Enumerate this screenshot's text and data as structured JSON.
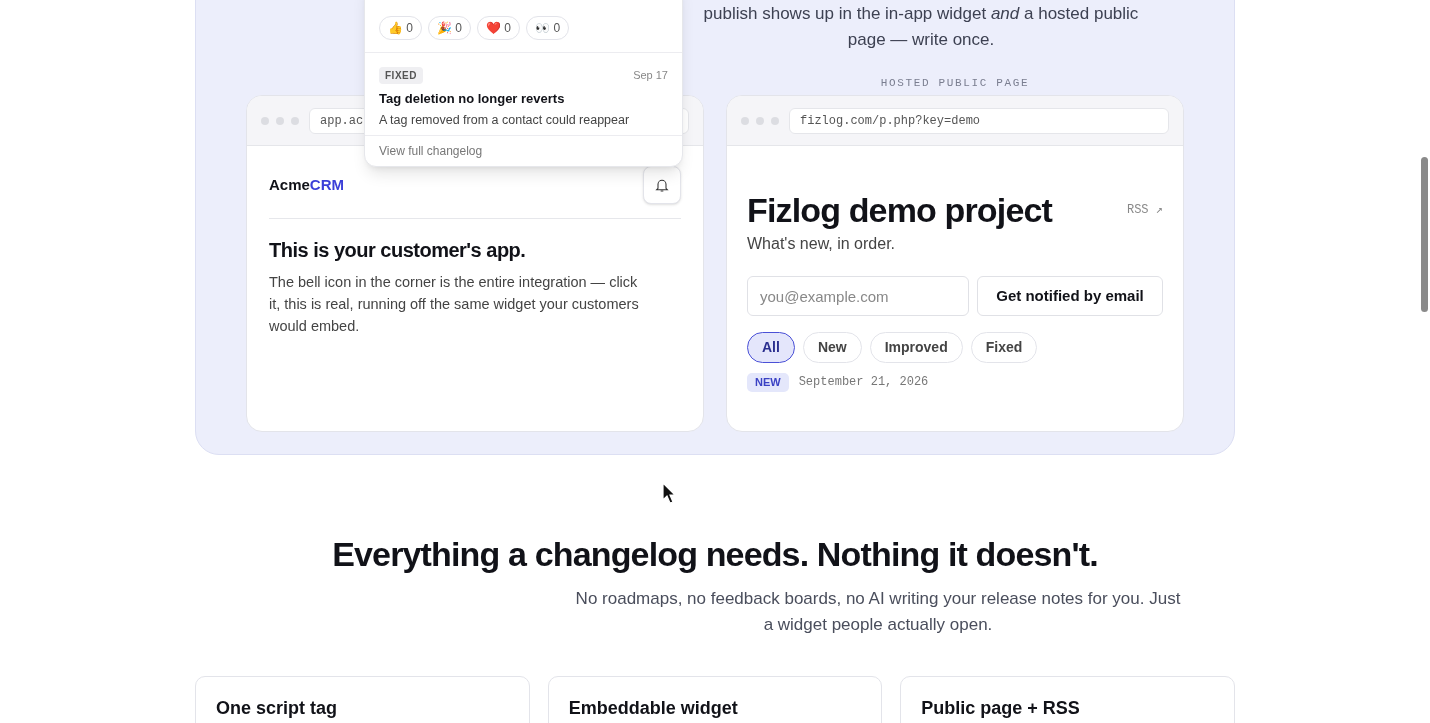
{
  "intro": {
    "text": "publish shows up in the in-app widget *and* a hosted public page — write once."
  },
  "widget_popup": {
    "reactions": [
      {
        "emoji": "👍",
        "count": "0"
      },
      {
        "emoji": "🎉",
        "count": "0"
      },
      {
        "emoji": "❤️",
        "count": "0"
      },
      {
        "emoji": "👀",
        "count": "0"
      }
    ],
    "entries": [
      {
        "tag": "FIXED",
        "date": "Sep 17",
        "title": "Tag deletion no longer reverts",
        "summary": "A tag removed from a contact could reappear"
      }
    ],
    "footer_link": "View full changelog"
  },
  "app_preview": {
    "url": "app.ac",
    "logo": {
      "name": "Acme",
      "accent": "CRM"
    },
    "heading": "This is your customer's app.",
    "body": "The bell icon in the corner is the entire integration — click it, this is real, running off the same widget your customers would embed."
  },
  "public_preview": {
    "label": "HOSTED PUBLIC PAGE",
    "url": "fizlog.com/p.php?key=demo",
    "title": "Fizlog demo project",
    "rss": "RSS ↗",
    "subtitle": "What's new, in order.",
    "email_placeholder": "you@example.com",
    "subscribe_button": "Get notified by email",
    "filters": [
      {
        "label": "All",
        "selected": true
      },
      {
        "label": "New",
        "selected": false
      },
      {
        "label": "Improved",
        "selected": false
      },
      {
        "label": "Fixed",
        "selected": false
      }
    ],
    "entry": {
      "tag": "NEW",
      "date": "September 21, 2026"
    }
  },
  "features": {
    "heading": "Everything a changelog needs. Nothing it doesn't.",
    "subheading": "No roadmaps, no feedback boards, no AI writing your release notes for you. Just a widget people actually open.",
    "cards": [
      {
        "title": "One script tag"
      },
      {
        "title": "Embeddable widget"
      },
      {
        "title": "Public page + RSS"
      }
    ]
  }
}
